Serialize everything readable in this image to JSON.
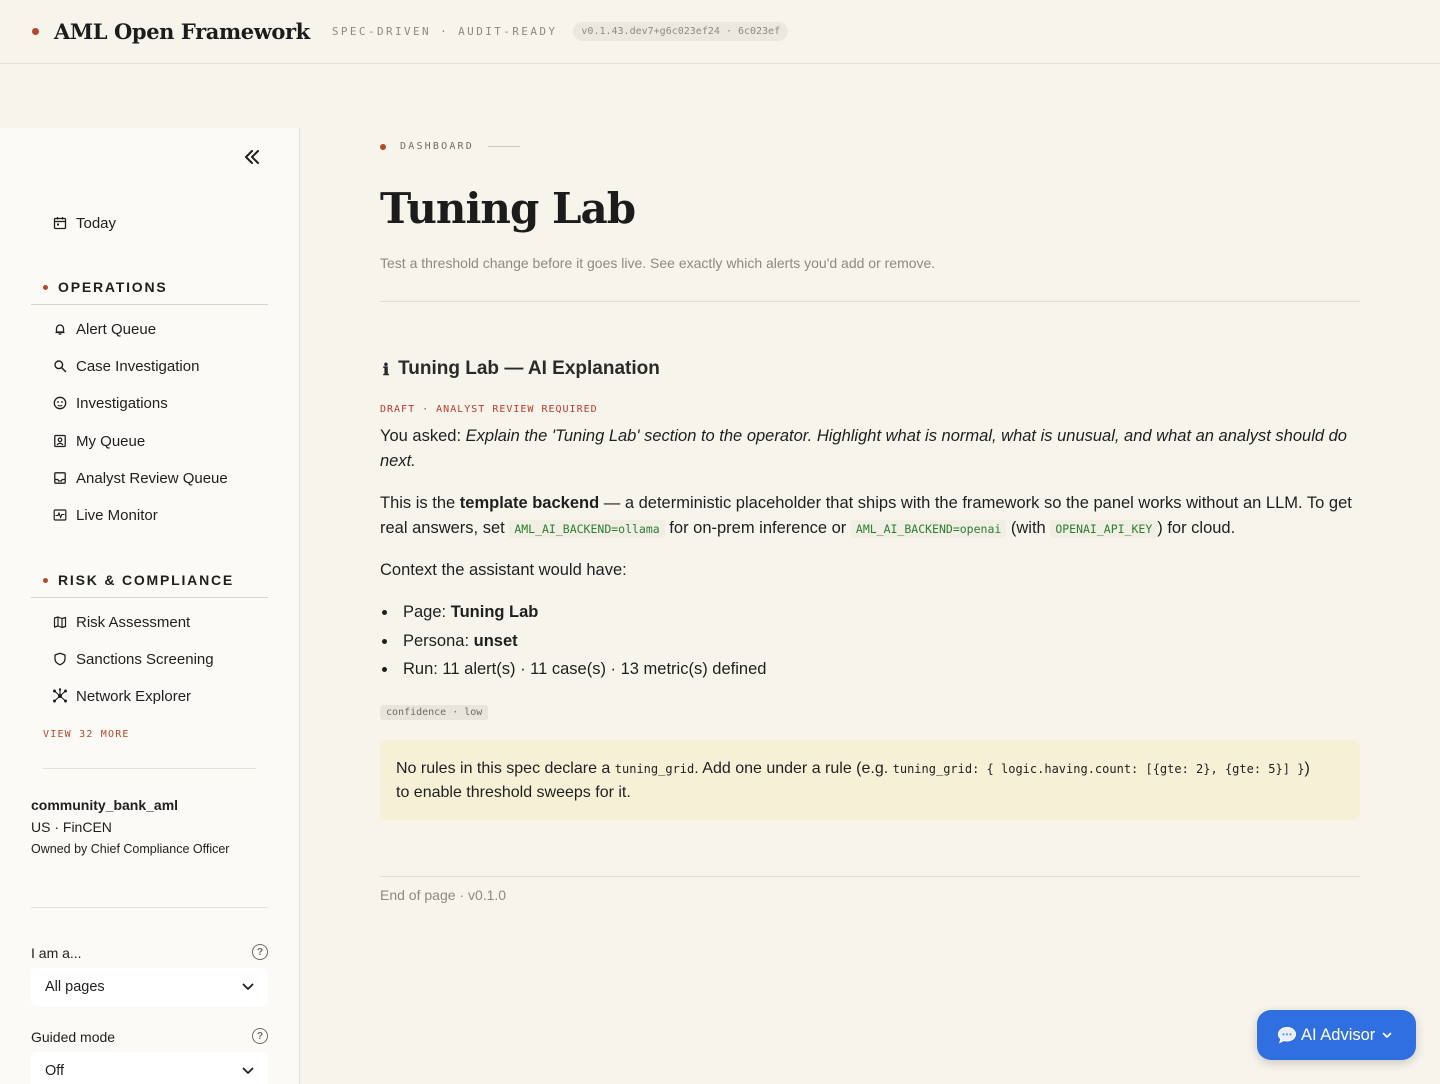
{
  "header": {
    "brand": "AML Open Framework",
    "tagline": "SPEC-DRIVEN · AUDIT-READY",
    "version": "v0.1.43.dev7+g6c023ef24 · 6c023ef"
  },
  "sidebar": {
    "today": "Today",
    "operations": {
      "title": "OPERATIONS",
      "items": [
        "Alert Queue",
        "Case Investigation",
        "Investigations",
        "My Queue",
        "Analyst Review Queue",
        "Live Monitor"
      ]
    },
    "risk": {
      "title": "RISK & COMPLIANCE",
      "items": [
        "Risk Assessment",
        "Sanctions Screening",
        "Network Explorer"
      ]
    },
    "view_more": "VIEW 32 MORE",
    "org": {
      "name": "community_bank_aml",
      "region": "US · FinCEN",
      "owner": "Owned by Chief Compliance Officer"
    },
    "persona": {
      "label": "I am a...",
      "value": "All pages"
    },
    "guided": {
      "label": "Guided mode",
      "value": "Off"
    }
  },
  "main": {
    "breadcrumb": "DASHBOARD",
    "title": "Tuning Lab",
    "subtitle": "Test a threshold change before it goes live. See exactly which alerts you'd add or remove.",
    "ai": {
      "title": "Tuning Lab — AI Explanation",
      "draft": "DRAFT · ANALYST REVIEW REQUIRED",
      "asked_prefix": "You asked: ",
      "asked": "Explain the 'Tuning Lab' section to the operator. Highlight what is normal, what is unusual, and what an analyst should do next.",
      "p2_a": "This is the ",
      "p2_b": "template backend",
      "p2_c": " — a deterministic placeholder that ships with the framework so the panel works without an LLM. To get real answers, set ",
      "p2_code1": "AML_AI_BACKEND=ollama",
      "p2_d": " for on-prem inference or ",
      "p2_code2": "AML_AI_BACKEND=openai",
      "p2_e": " (with ",
      "p2_code3": "OPENAI_API_KEY",
      "p2_f": ") for cloud.",
      "context": "Context the assistant would have:",
      "page_label": "Page: ",
      "page_value": "Tuning Lab",
      "persona_label": "Persona: ",
      "persona_value": "unset",
      "run": "Run: 11 alert(s) · 11 case(s) · 13 metric(s) defined",
      "confidence": "confidence · low"
    },
    "note": {
      "a": "No rules in this spec declare a ",
      "code1": "tuning_grid",
      "b": ". Add one under a rule (e.g. ",
      "code2": "tuning_grid: { logic.having.count: [{gte: 2}, {gte: 5}] }",
      "c": ")",
      "d": "to enable threshold sweeps for it."
    },
    "end": "End of page · v0.1.0"
  },
  "advisor": {
    "label": "AI Advisor"
  }
}
